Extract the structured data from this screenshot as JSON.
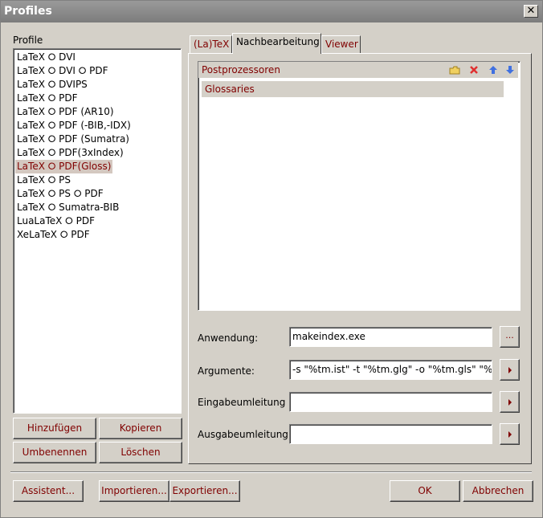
{
  "window": {
    "title": "Profiles",
    "close_glyph": "✕"
  },
  "profiles": {
    "label": "Profile",
    "items": [
      "LaTeX ⭘ DVI",
      "LaTeX ⭘ DVI ⭘ PDF",
      "LaTeX ⭘ DVIPS",
      "LaTeX ⭘ PDF",
      "LaTeX ⭘ PDF (AR10)",
      "LaTeX ⭘ PDF (-BIB,-IDX)",
      "LaTeX ⭘ PDF (Sumatra)",
      "LaTeX ⭘ PDF(3xIndex)",
      "LaTeX ⭘ PDF(Gloss)",
      "LaTeX ⭘ PS",
      "LaTeX ⭘ PS ⭘ PDF",
      "LaTeX ⭘ Sumatra-BIB",
      "LuaLaTeX ⭘ PDF",
      "XeLaTeX ⭘ PDF"
    ],
    "selected_index": 8,
    "buttons": {
      "add": "Hinzufügen",
      "copy": "Kopieren",
      "rename": "Umbenennen",
      "delete": "Löschen"
    }
  },
  "tabs": {
    "latex": "(La)TeX",
    "post": "Nachbearbeitung",
    "viewer": "Viewer",
    "active": "post"
  },
  "postprocessors": {
    "header": "Postprozessoren",
    "items": [
      "Glossaries"
    ],
    "toolbar_icons": [
      "folder-icon",
      "delete-x-icon",
      "move-up-icon",
      "move-down-icon"
    ]
  },
  "fields": {
    "application": {
      "label": "Anwendung:",
      "value": "makeindex.exe",
      "button": "..."
    },
    "arguments": {
      "label": "Argumente:",
      "value": "-s \"%tm.ist\" -t \"%tm.glg\" -o \"%tm.gls\" \"%tm.glo\""
    },
    "input_redirect": {
      "label": "Eingabeumleitung",
      "value": ""
    },
    "output_redirect": {
      "label": "Ausgabeumleitung",
      "value": ""
    }
  },
  "footer": {
    "assistant": "Assistent...",
    "import": "Importieren...",
    "export": "Exportieren...",
    "ok": "OK",
    "cancel": "Abbrechen"
  },
  "colors": {
    "accent_text": "#800000",
    "face": "#d4d0c8",
    "titlebar": "#808080"
  }
}
